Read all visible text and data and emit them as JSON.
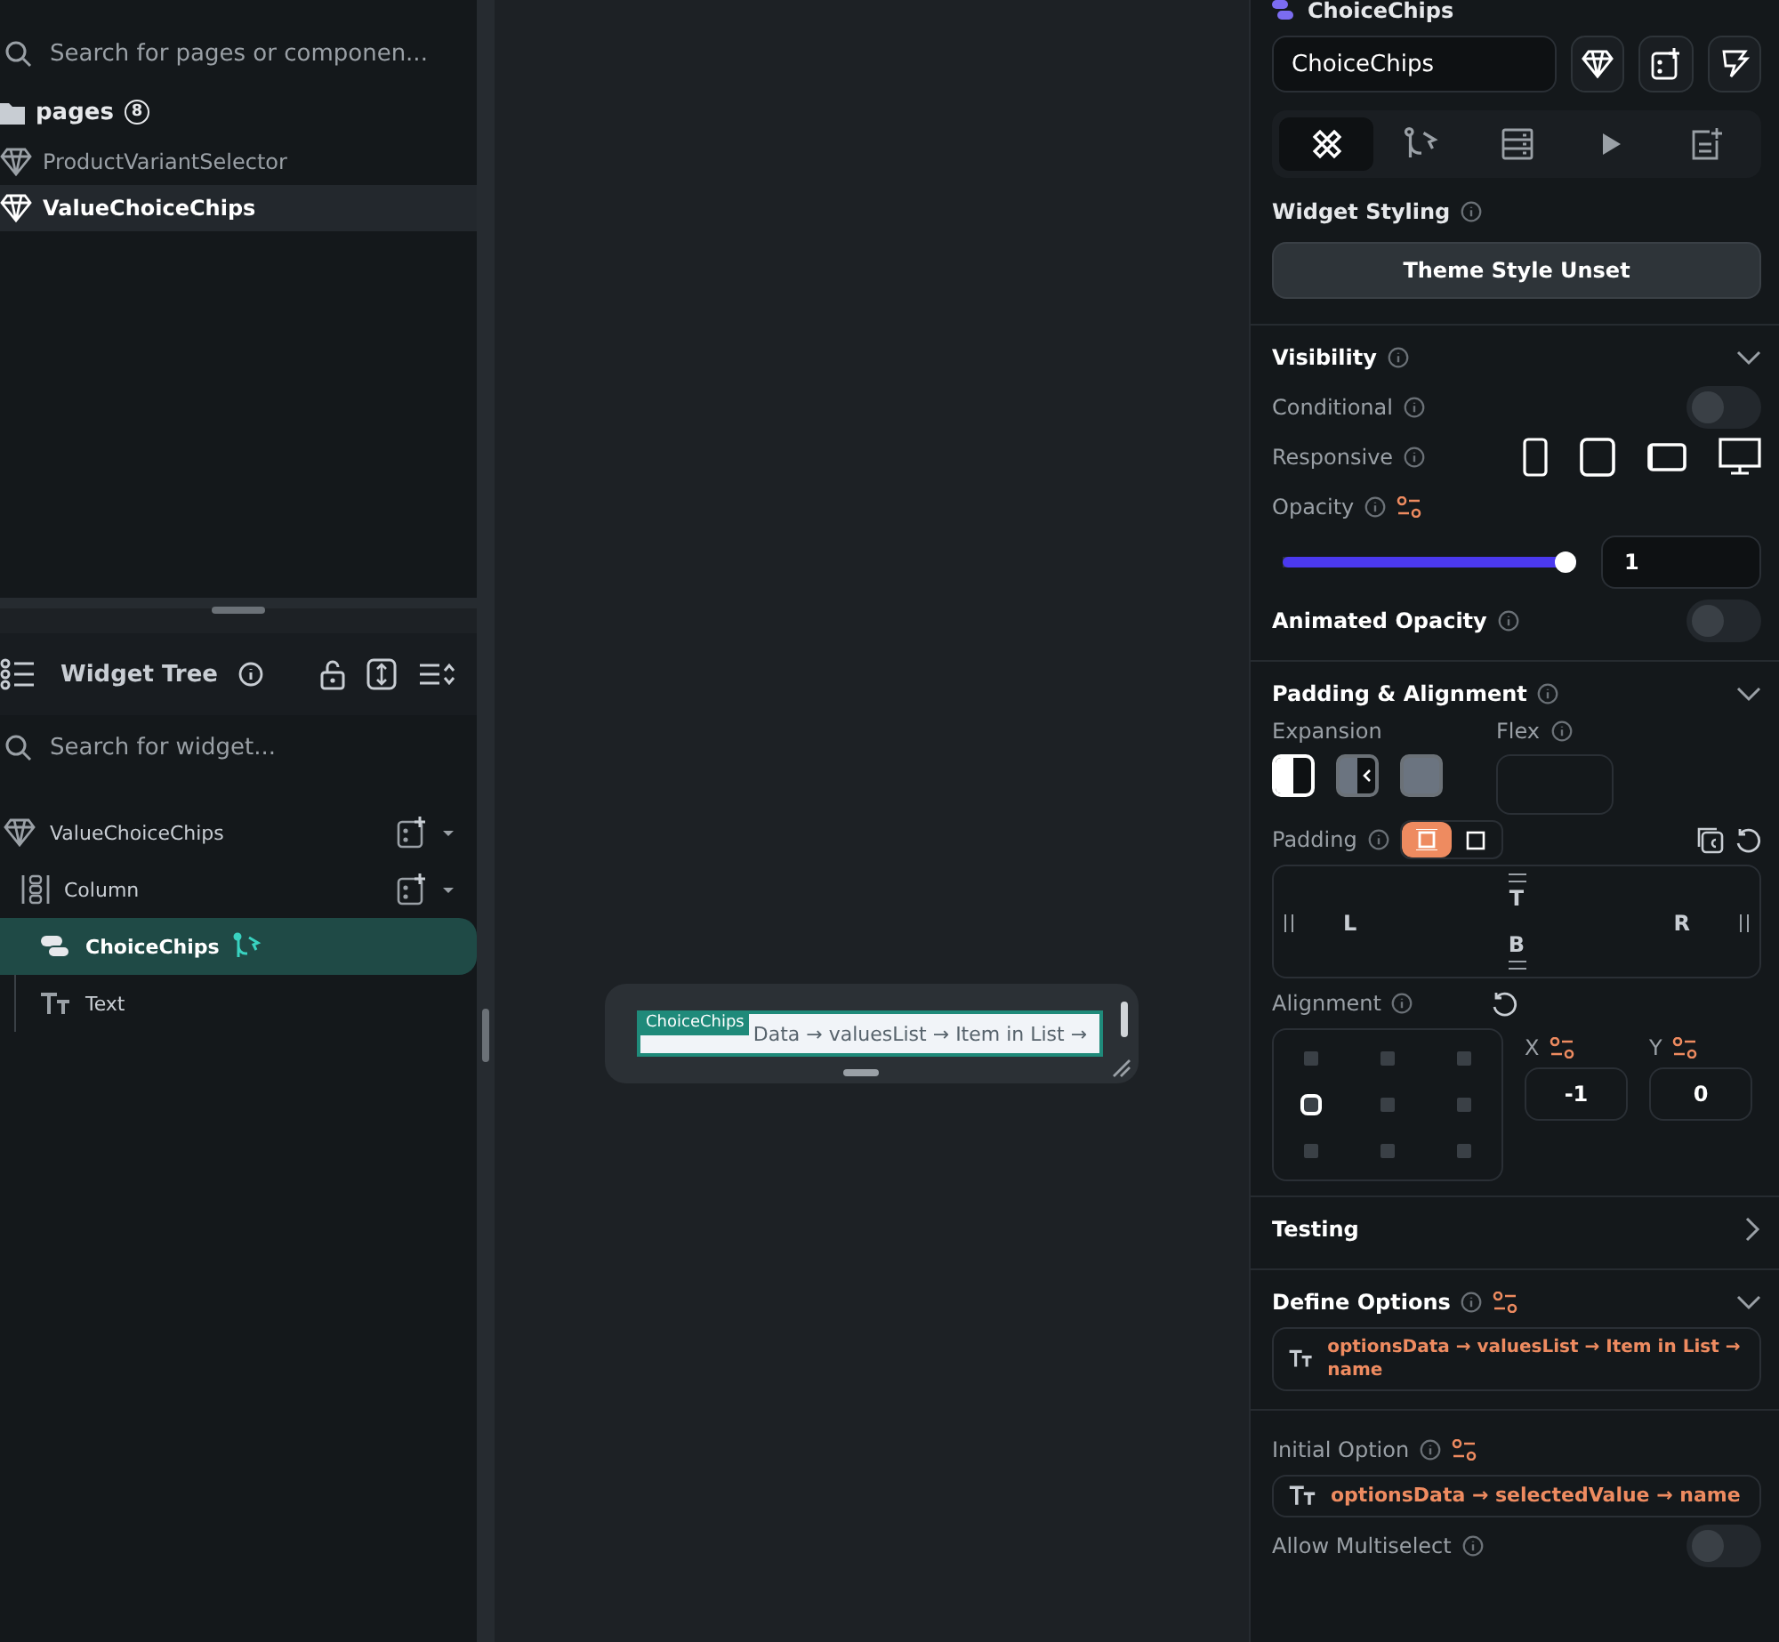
{
  "pages_panel": {
    "search_placeholder": "Search for pages or componen...",
    "folder": {
      "label": "pages",
      "count": "8"
    },
    "items": [
      {
        "label": "ProductVariantSelector",
        "selected": false
      },
      {
        "label": "ValueChoiceChips",
        "selected": true
      }
    ]
  },
  "widget_tree": {
    "title": "Widget Tree",
    "search_placeholder": "Search for widget...",
    "nodes": [
      {
        "label": "ValueChoiceChips",
        "kind": "component",
        "selected": false,
        "children": [
          {
            "label": "Column",
            "kind": "column",
            "selected": false,
            "children": [
              {
                "label": "ChoiceChips",
                "kind": "chips",
                "selected": true
              },
              {
                "label": "Text",
                "kind": "text",
                "selected": false
              }
            ]
          }
        ]
      }
    ]
  },
  "canvas": {
    "widget_tag": "ChoiceChips",
    "chip_text": "Data → valuesList → Item in List →"
  },
  "properties": {
    "widget_type": "ChoiceChips",
    "name_value": "ChoiceChips",
    "tabs": [
      {
        "kind": "style",
        "selected": true
      },
      {
        "kind": "actions",
        "selected": false
      },
      {
        "kind": "backend",
        "selected": false
      },
      {
        "kind": "preview",
        "selected": false
      },
      {
        "kind": "notes",
        "selected": false
      }
    ],
    "widget_styling": {
      "title": "Widget Styling",
      "button": "Theme Style Unset"
    },
    "visibility": {
      "title": "Visibility",
      "expanded": true,
      "conditional": {
        "label": "Conditional",
        "on": false
      },
      "responsive_label": "Responsive",
      "opacity": {
        "label": "Opacity",
        "level": 1,
        "value": "1"
      },
      "animated_opacity": {
        "label": "Animated Opacity",
        "on": false
      }
    },
    "padding_alignment": {
      "title": "Padding & Alignment",
      "expanded": true,
      "expansion_label": "Expansion",
      "expansion_options": [
        {
          "kind": "default",
          "selected": true
        },
        {
          "kind": "flexible",
          "selected": false
        },
        {
          "kind": "expanded",
          "selected": false
        }
      ],
      "flex_label": "Flex",
      "padding_label": "Padding",
      "padding_modes": [
        {
          "kind": "all",
          "selected": true
        },
        {
          "kind": "single",
          "selected": false
        }
      ],
      "sides": {
        "top": "T",
        "left": "L",
        "right": "R",
        "bottom": "B"
      },
      "alignment_label": "Alignment",
      "alignment_cells": [
        {
          "selected": false
        },
        {
          "selected": false
        },
        {
          "selected": false
        },
        {
          "selected": true
        },
        {
          "selected": false
        },
        {
          "selected": false
        },
        {
          "selected": false
        },
        {
          "selected": false
        },
        {
          "selected": false
        }
      ],
      "x": {
        "label": "X",
        "value": "-1"
      },
      "y": {
        "label": "Y",
        "value": "0"
      }
    },
    "testing": {
      "title": "Testing",
      "expanded": false
    },
    "define_options": {
      "title": "Define Options",
      "expanded": true,
      "value": "optionsData → valuesList → Item in List → name"
    },
    "initial_option": {
      "label": "Initial Option",
      "value": "optionsData → selectedValue → name"
    },
    "allow_multiselect": {
      "label": "Allow Multiselect",
      "on": false
    }
  }
}
